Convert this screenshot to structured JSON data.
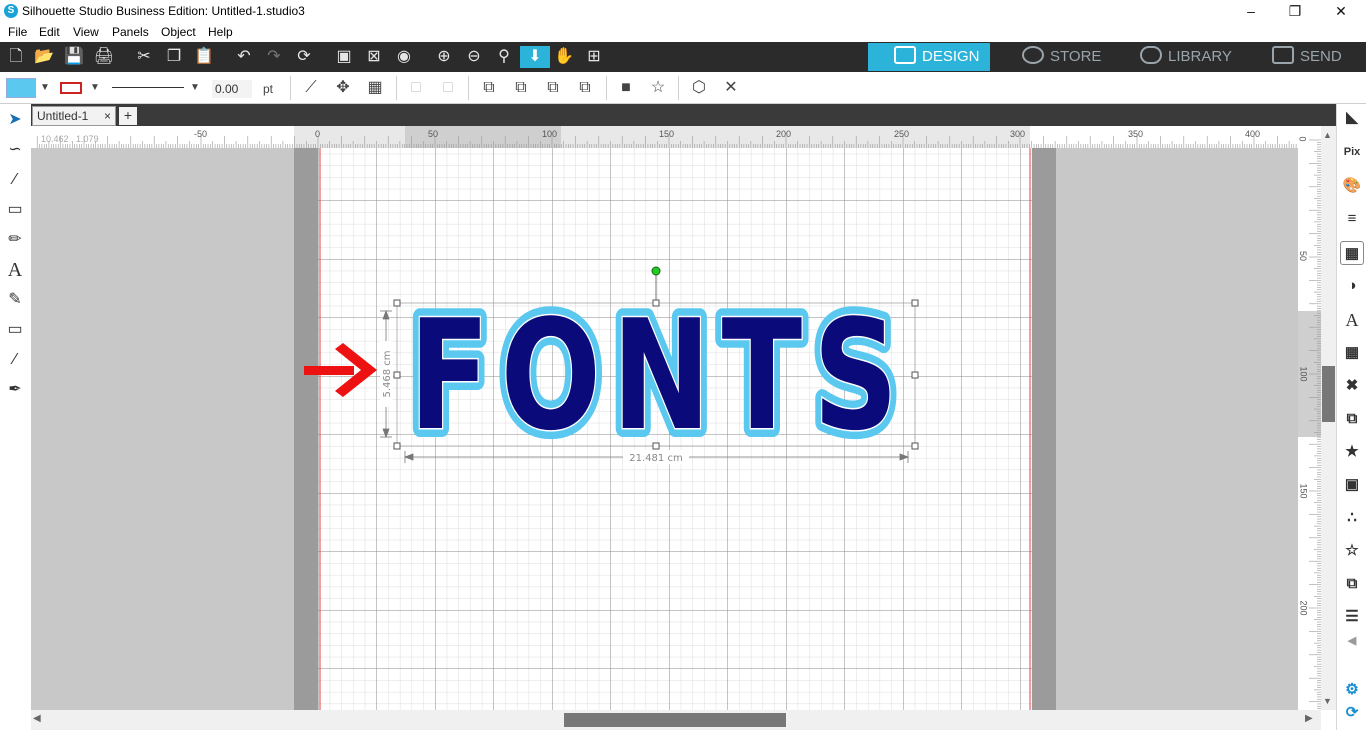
{
  "window": {
    "title": "Silhouette Studio Business Edition: Untitled-1.studio3",
    "controls": [
      "minimize",
      "restore",
      "close"
    ]
  },
  "menu": [
    "File",
    "Edit",
    "View",
    "Panels",
    "Object",
    "Help"
  ],
  "nav_tabs": [
    {
      "label": "DESIGN",
      "active": true
    },
    {
      "label": "STORE",
      "active": false
    },
    {
      "label": "LIBRARY",
      "active": false
    },
    {
      "label": "SEND",
      "active": false
    }
  ],
  "toolbar": {
    "fill_color": "#5bc8f0",
    "line_color": "#cc2222",
    "line_width_value": "0.00",
    "line_width_unit": "pt"
  },
  "document": {
    "tab_label": "Untitled-1",
    "close_glyph": "×",
    "add_glyph": "+"
  },
  "ruler": {
    "coords": "10.462 , 1.079",
    "h_labels": [
      "-50",
      "0",
      "50",
      "100",
      "150",
      "200",
      "250",
      "300",
      "350",
      "400"
    ],
    "v_labels": [
      "0",
      "50",
      "100",
      "150",
      "200"
    ]
  },
  "design": {
    "text": "FONTS",
    "width_label": "21.481 cm",
    "height_label": "5.468 cm",
    "fill_color": "#0a0a7a",
    "outline_color": "#5bc8f0",
    "arrow_color": "#ee1111"
  },
  "colors": {
    "dark_bar": "#2b2b2b",
    "accent": "#2cb3d9"
  }
}
